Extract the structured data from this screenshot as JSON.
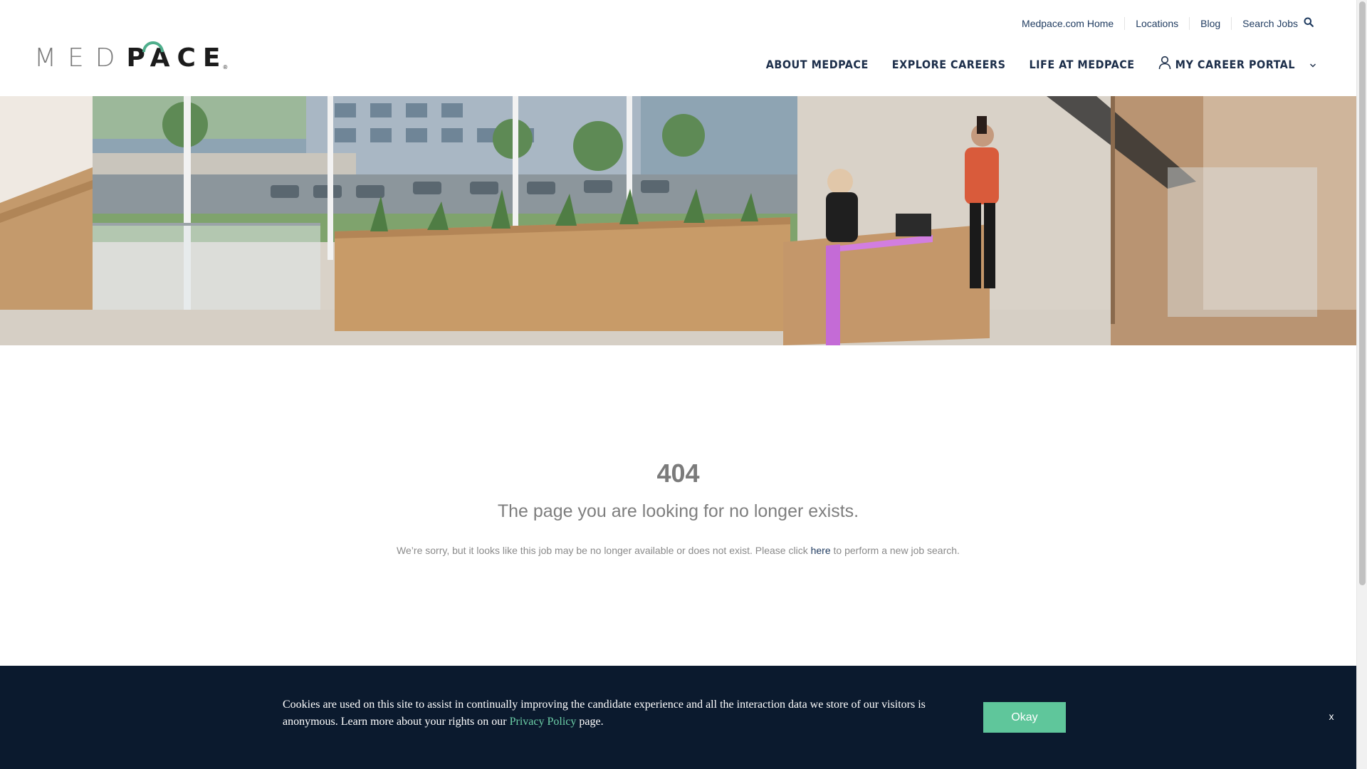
{
  "brand": {
    "logo_light": "MED",
    "logo_bold": "PACE",
    "logo_reg": "®",
    "accent_color": "#4fae8c"
  },
  "util_nav": {
    "items": [
      {
        "label": "Medpace.com Home"
      },
      {
        "label": "Locations"
      },
      {
        "label": "Blog"
      }
    ],
    "search_label": "Search Jobs",
    "search_icon": "search-icon"
  },
  "main_nav": {
    "items": [
      {
        "label": "ABOUT MEDPACE"
      },
      {
        "label": "EXPLORE CAREERS"
      },
      {
        "label": "LIFE AT MEDPACE"
      }
    ],
    "portal_label": "MY CAREER PORTAL",
    "portal_icon": "user-icon",
    "portal_chevron": "chevron-down-icon"
  },
  "error": {
    "code": "404",
    "title": "The page you are looking for no longer exists.",
    "desc_before": "We’re sorry, but it looks like this job may be no longer available or does not exist. Please click ",
    "desc_link": "here",
    "desc_after": " to perform a new job search."
  },
  "cookie": {
    "text_before": "Cookies are used on this site to assist in continually improving the candidate experience and all the interaction data we store of our visitors is anonymous. Learn more about your rights on our ",
    "link_label": "Privacy Policy",
    "text_after": " page.",
    "okay_label": "Okay",
    "close_label": "x",
    "bg_color": "#0b1a2e",
    "button_color": "#5fc69b"
  }
}
